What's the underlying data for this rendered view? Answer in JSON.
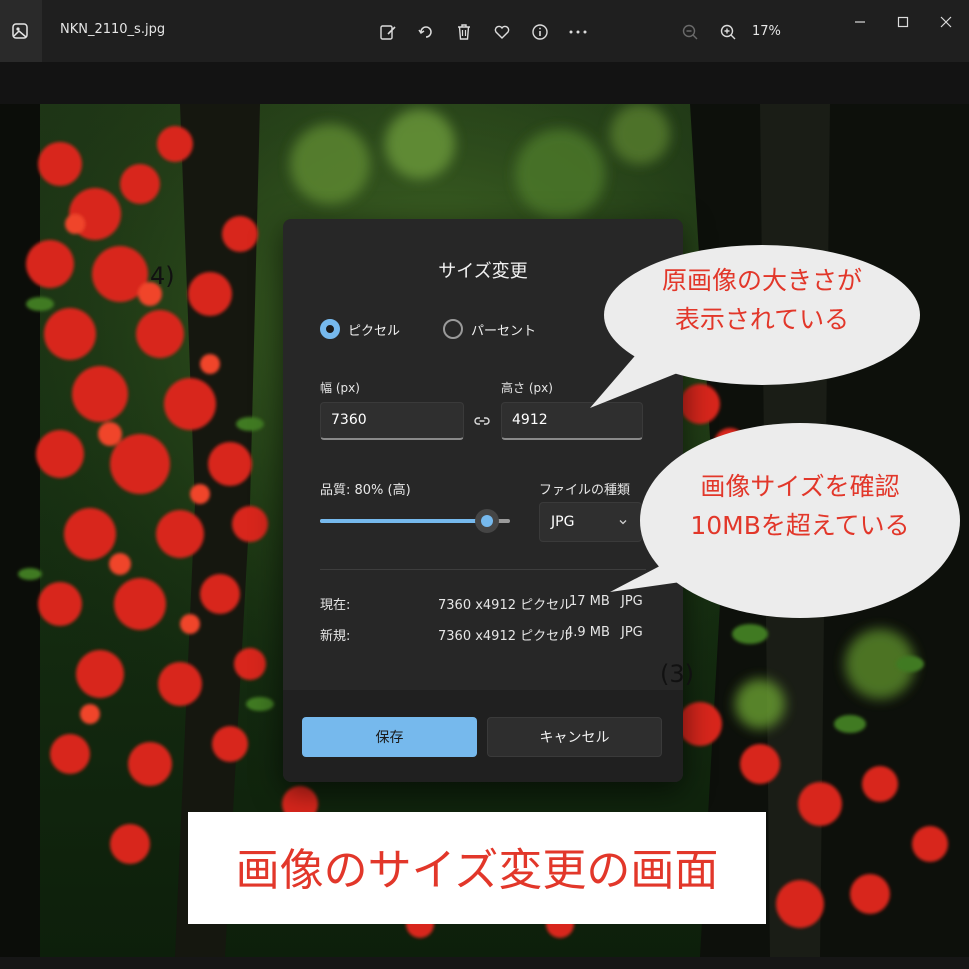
{
  "titlebar": {
    "filename": "NKN_2110_s.jpg",
    "zoom": "17%",
    "icons": [
      "edit-icon",
      "rotate-icon",
      "delete-icon",
      "favorite-icon",
      "info-icon",
      "more-icon",
      "zoom-out-icon",
      "zoom-in-icon"
    ]
  },
  "dialog": {
    "title": "サイズ変更",
    "radio_pixel": "ピクセル",
    "radio_percent": "パーセント",
    "selected_mode": "pixel",
    "width_label": "幅 (px)",
    "width_value": "7360",
    "height_label": "高さ (px)",
    "height_value": "4912",
    "quality_label": "品質: 80% (高)",
    "quality_value": 80,
    "filetype_label": "ファイルの種類",
    "filetype_value": "JPG",
    "current": {
      "label": "現在:",
      "dims": "7360 x4912 ピクセル",
      "size": "17 MB",
      "type": "JPG"
    },
    "new": {
      "label": "新規:",
      "dims": "7360 x4912 ピクセル",
      "size": "4.9 MB",
      "type": "JPG"
    },
    "save": "保存",
    "cancel": "キャンセル"
  },
  "annotations": {
    "bubble1_line1": "原画像の大きさが",
    "bubble1_line2": "表示されている",
    "bubble2_line1": "画像サイズを確認",
    "bubble2_line2": "10MBを超えている",
    "step3": "(3)",
    "step4": "4)",
    "caption": "画像のサイズ変更の画面"
  },
  "colors": {
    "accent": "#76b9ed",
    "annotation_red": "#e2372a",
    "dialog_bg": "#272727"
  }
}
